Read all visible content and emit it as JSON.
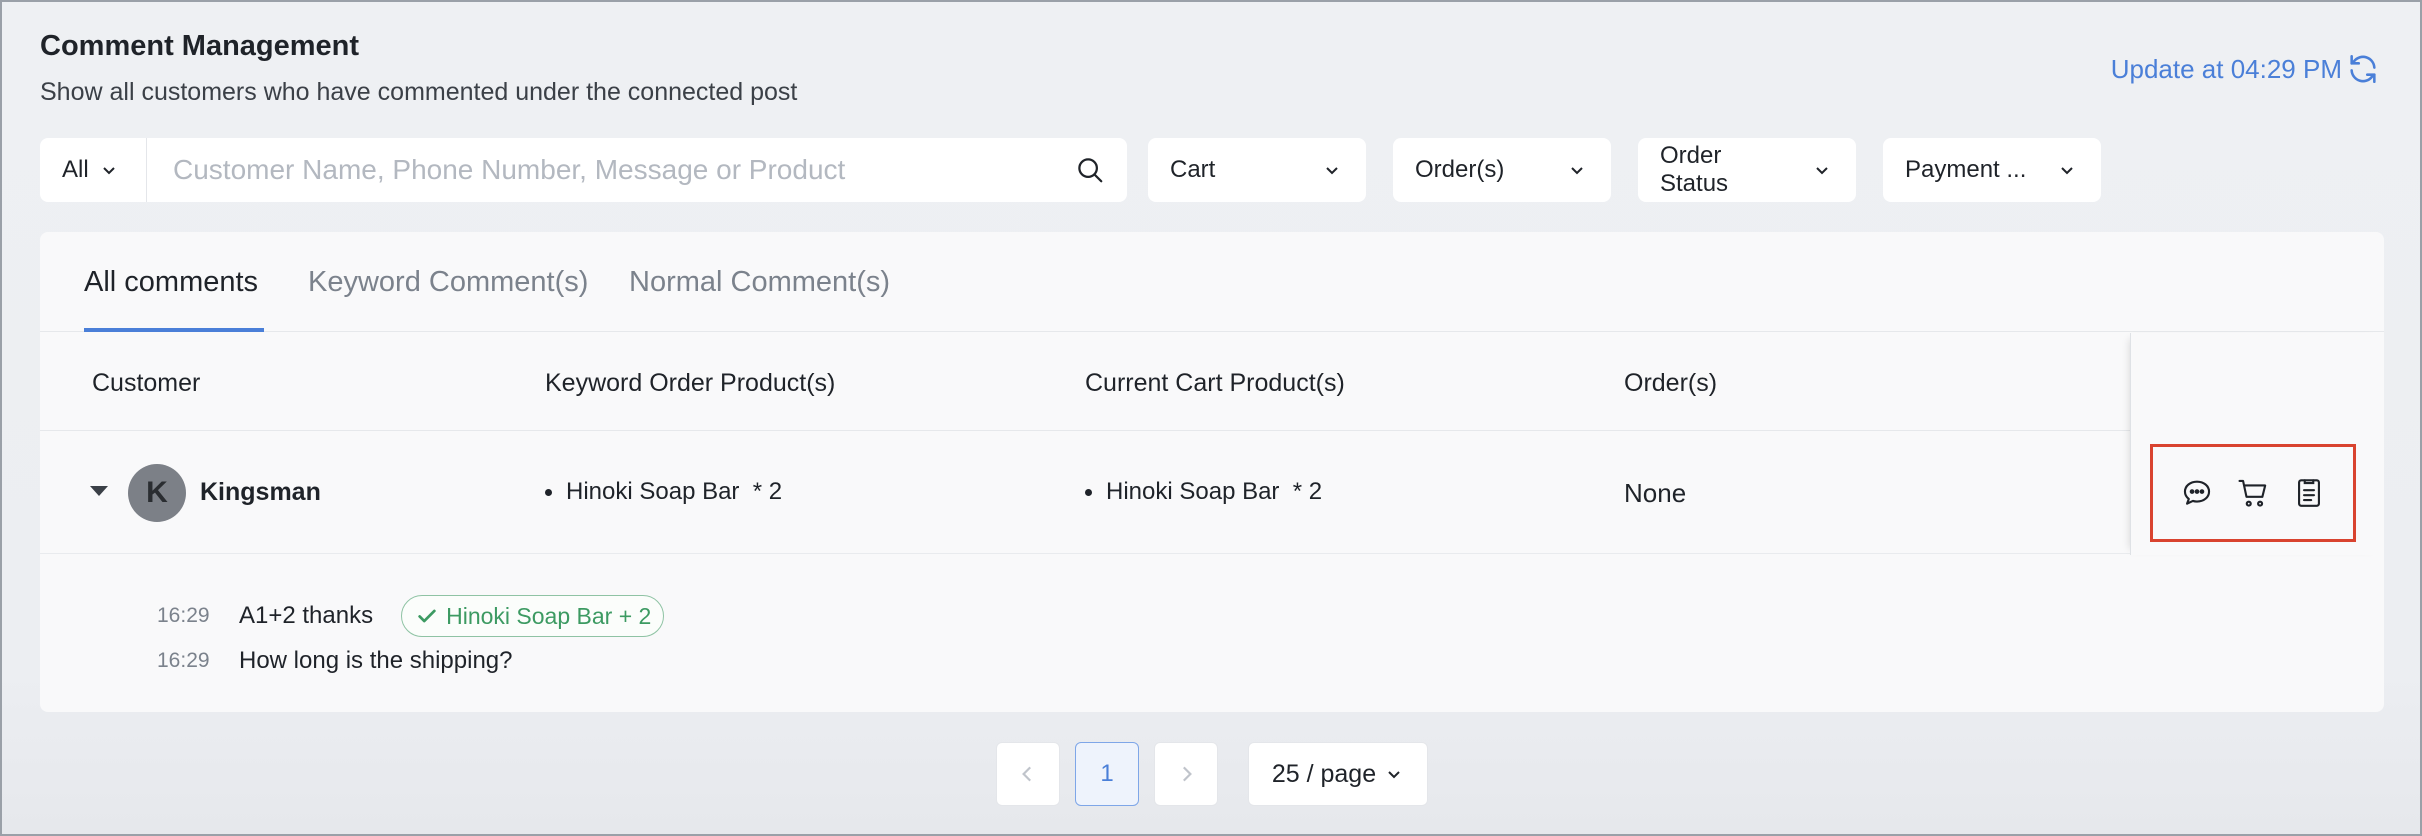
{
  "header": {
    "title": "Comment Management",
    "subtitle": "Show all customers who have commented under the connected post",
    "update_label": "Update at 04:29 PM"
  },
  "filters": {
    "scope_value": "All",
    "search_placeholder": "Customer Name, Phone Number, Message or Product",
    "cart_label": "Cart",
    "orders_label": "Order(s)",
    "order_status_label": "Order Status",
    "payment_label": "Payment ..."
  },
  "tabs": [
    {
      "label": "All comments",
      "active": true
    },
    {
      "label": "Keyword Comment(s)",
      "active": false
    },
    {
      "label": "Normal Comment(s)",
      "active": false
    }
  ],
  "table": {
    "headers": [
      "Customer",
      "Keyword Order Product(s)",
      "Current Cart Product(s)",
      "Order(s)"
    ],
    "rows": [
      {
        "avatar_letter": "K",
        "customer": "Kingsman",
        "keyword_product": "Hinoki Soap Bar  * 2",
        "cart_product": "Hinoki Soap Bar  * 2",
        "orders": "None"
      }
    ]
  },
  "comments": [
    {
      "time": "16:29",
      "text": "A1+2 thanks",
      "tag": "Hinoki Soap Bar + 2"
    },
    {
      "time": "16:29",
      "text": "How long is the shipping?"
    }
  ],
  "pagination": {
    "current_page": "1",
    "page_size": "25 / page"
  },
  "colors": {
    "accent": "#4a7fd8",
    "highlight_box": "#d9432f",
    "tag_green": "#3c9a62"
  },
  "icons": {
    "refresh": "refresh-icon",
    "search": "search-icon",
    "message": "message-icon",
    "cart": "cart-icon",
    "order": "order-icon"
  }
}
